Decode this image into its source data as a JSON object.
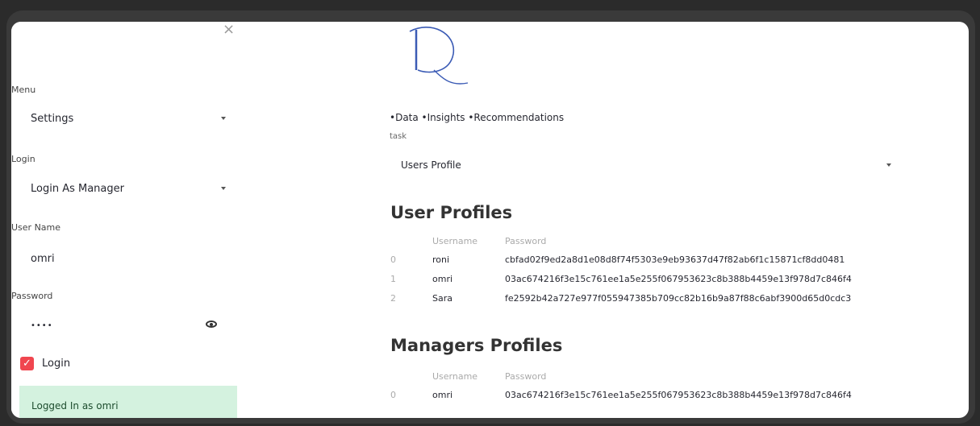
{
  "sidebar": {
    "close_icon": "×",
    "menu_label": "Menu",
    "menu_value": "Settings",
    "login_label": "Login",
    "login_value": "Login As Manager",
    "username_label": "User Name",
    "username_value": "omri",
    "password_label": "Password",
    "password_value": "••••",
    "checkbox_label": "Login",
    "checkbox_checked": true,
    "success_message": "Logged In as omri"
  },
  "main": {
    "tagline": "•Data •Insights •Recommendations",
    "task_label": "task",
    "task_value": "Users Profile",
    "user_profiles": {
      "title": "User Profiles",
      "headers": [
        "",
        "Username",
        "Password"
      ],
      "rows": [
        [
          "0",
          "roni",
          "cbfad02f9ed2a8d1e08d8f74f5303e9eb93637d47f82ab6f1c15871cf8dd0481"
        ],
        [
          "1",
          "omri",
          "03ac674216f3e15c761ee1a5e255f067953623c8b388b4459e13f978d7c846f4"
        ],
        [
          "2",
          "Sara",
          "fe2592b42a727e977f055947385b709cc82b16b9a87f88c6abf3900d65d0cdc3"
        ]
      ]
    },
    "managers_profiles": {
      "title": "Managers Profiles",
      "headers": [
        "",
        "Username",
        "Password"
      ],
      "rows": [
        [
          "0",
          "omri",
          "03ac674216f3e15c761ee1a5e255f067953623c8b388b4459e13f978d7c846f4"
        ]
      ]
    }
  },
  "colors": {
    "checkbox": "#f0464f",
    "success_bg": "#d4f2df",
    "logo": "#3b5bb5"
  }
}
